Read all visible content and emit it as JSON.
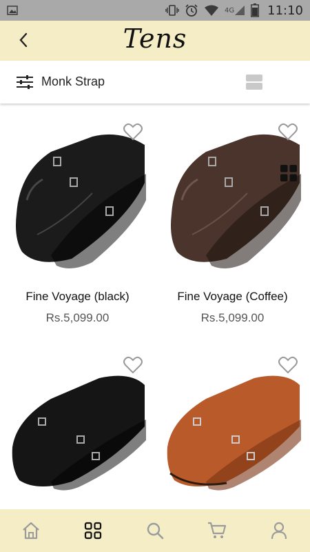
{
  "status_bar": {
    "time": "11:10",
    "network_label": "4G",
    "icons": [
      "gallery-icon",
      "vibrate-icon",
      "alarm-icon",
      "wifi-icon",
      "signal-icon",
      "battery-icon"
    ]
  },
  "header": {
    "logo_text": "Tens",
    "background": "#f4edc6"
  },
  "toolbar": {
    "category": "Monk Strap",
    "icons": [
      "filter-sliders-icon",
      "list-view-icon",
      "grid-view-icon"
    ],
    "active_view": "grid"
  },
  "products": [
    {
      "name": "Fine Voyage (black)",
      "price": "Rs.5,099.00",
      "color": "#1b1b1b"
    },
    {
      "name": "Fine Voyage (Coffee)",
      "price": "Rs.5,099.00",
      "color": "#4a342c"
    },
    {
      "name": "",
      "price": "",
      "color": "#151515"
    },
    {
      "name": "",
      "price": "",
      "color": "#b85a2a"
    }
  ],
  "bottom_nav": {
    "items": [
      {
        "icon": "home-icon",
        "active": false
      },
      {
        "icon": "categories-grid-icon",
        "active": true
      },
      {
        "icon": "search-icon",
        "active": false
      },
      {
        "icon": "cart-icon",
        "active": false
      },
      {
        "icon": "profile-icon",
        "active": false
      }
    ],
    "active_color": "#111111",
    "inactive_color": "#9b9b9b"
  }
}
